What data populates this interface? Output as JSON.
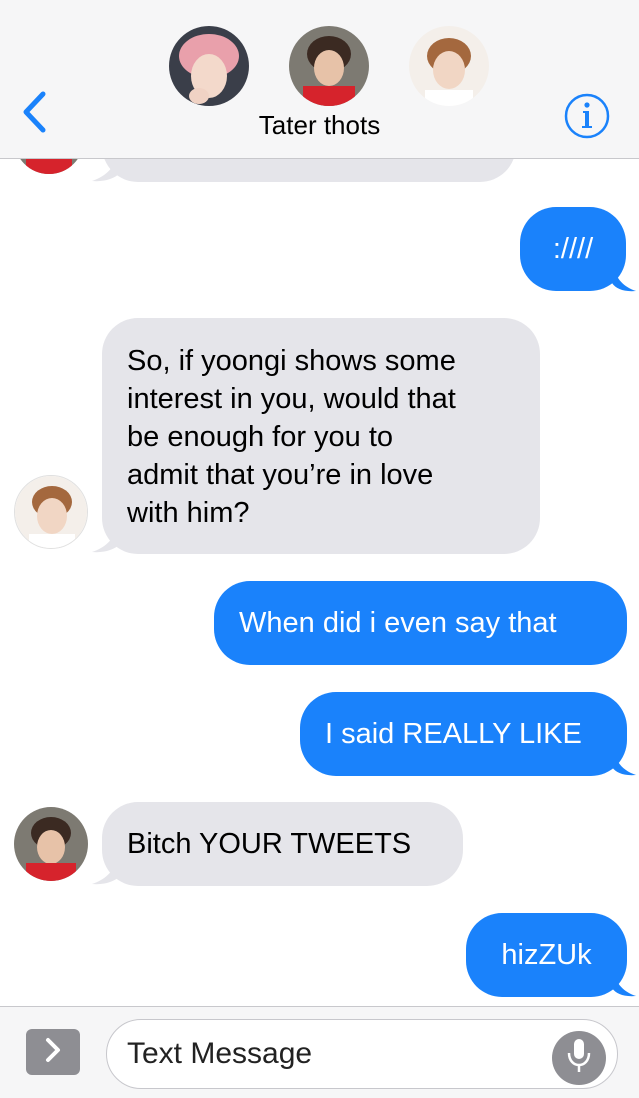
{
  "header": {
    "title": "Tater thots",
    "back_icon": "chevron-left-icon",
    "info_icon": "info-icon",
    "accent": "#1a82fb"
  },
  "messages": [
    {
      "id": "m0",
      "direction": "incoming",
      "text": ""
    },
    {
      "id": "m1",
      "direction": "outgoing",
      "text": ":////"
    },
    {
      "id": "m2",
      "direction": "incoming",
      "lines": [
        "So, if yoongi shows some",
        "interest in you, would that",
        "be enough for you to",
        "admit that you’re in love",
        "with him?"
      ]
    },
    {
      "id": "m3",
      "direction": "outgoing",
      "text": "When did i even say that"
    },
    {
      "id": "m4",
      "direction": "outgoing",
      "text": "I said REALLY LIKE"
    },
    {
      "id": "m5",
      "direction": "incoming",
      "text": "Bitch YOUR TWEETS"
    },
    {
      "id": "m6",
      "direction": "outgoing",
      "text": "hizZUk"
    }
  ],
  "composer": {
    "placeholder": "Text Message",
    "apps_icon": "chevron-right-icon",
    "mic_icon": "microphone-icon"
  },
  "colors": {
    "incoming_bubble": "#e5e5ea",
    "outgoing_bubble": "#1a82fb",
    "header_bg": "#f6f6f7"
  }
}
